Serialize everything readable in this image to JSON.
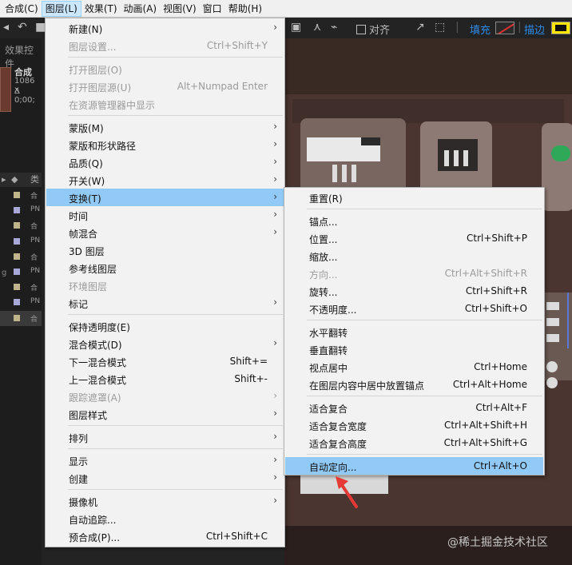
{
  "menubar": {
    "items": [
      {
        "label": "合成(C)",
        "active": false
      },
      {
        "label": "图层(L)",
        "active": true
      },
      {
        "label": "效果(T)",
        "active": false
      },
      {
        "label": "动画(A)",
        "active": false
      },
      {
        "label": "视图(V)",
        "active": false
      },
      {
        "label": "窗口",
        "active": false
      },
      {
        "label": "帮助(H)",
        "active": false
      }
    ]
  },
  "toolbar": {
    "align_label": "对齐",
    "fill_label": "填充",
    "stroke_label": "描边",
    "stroke_color": "#ffe600",
    "fill_none_color": "#dd3333"
  },
  "left_panel": {
    "header": "效果控件",
    "comp_name": "合成",
    "comp_size": "1086 x",
    "comp_duration": "Δ 0;00;",
    "list_header": "类",
    "rows": [
      {
        "text": "合",
        "swatch": "#bfb48a"
      },
      {
        "text": "PN",
        "swatch": "#a8a8d8"
      },
      {
        "text": "合",
        "swatch": "#bfb48a"
      },
      {
        "text": "PN",
        "swatch": "#a8a8d8"
      },
      {
        "text": "合",
        "swatch": "#bfb48a"
      },
      {
        "text": "PN",
        "swatch": "#a8a8d8"
      },
      {
        "text": "合",
        "swatch": "#bfb48a"
      },
      {
        "text": "PN",
        "swatch": "#a8a8d8"
      },
      {
        "text": "合",
        "swatch": "#bfb48a"
      }
    ],
    "side_letter": "g"
  },
  "layer_menu": {
    "items": [
      {
        "type": "item",
        "label": "新建(N)",
        "shortcut": "",
        "submenu": true,
        "disabled": false
      },
      {
        "type": "item",
        "label": "图层设置...",
        "shortcut": "Ctrl+Shift+Y",
        "submenu": false,
        "disabled": true
      },
      {
        "type": "sep"
      },
      {
        "type": "item",
        "label": "打开图层(O)",
        "shortcut": "",
        "submenu": false,
        "disabled": true
      },
      {
        "type": "item",
        "label": "打开图层源(U)",
        "shortcut": "Alt+Numpad Enter",
        "submenu": false,
        "disabled": true
      },
      {
        "type": "item",
        "label": "在资源管理器中显示",
        "shortcut": "",
        "submenu": false,
        "disabled": true
      },
      {
        "type": "sep"
      },
      {
        "type": "item",
        "label": "蒙版(M)",
        "shortcut": "",
        "submenu": true,
        "disabled": false
      },
      {
        "type": "item",
        "label": "蒙版和形状路径",
        "shortcut": "",
        "submenu": true,
        "disabled": false
      },
      {
        "type": "item",
        "label": "品质(Q)",
        "shortcut": "",
        "submenu": true,
        "disabled": false
      },
      {
        "type": "item",
        "label": "开关(W)",
        "shortcut": "",
        "submenu": true,
        "disabled": false
      },
      {
        "type": "item",
        "label": "变换(T)",
        "shortcut": "",
        "submenu": true,
        "disabled": false,
        "highlight": true
      },
      {
        "type": "item",
        "label": "时间",
        "shortcut": "",
        "submenu": true,
        "disabled": false
      },
      {
        "type": "item",
        "label": "帧混合",
        "shortcut": "",
        "submenu": true,
        "disabled": false
      },
      {
        "type": "item",
        "label": "3D 图层",
        "shortcut": "",
        "submenu": false,
        "disabled": false
      },
      {
        "type": "item",
        "label": "参考线图层",
        "shortcut": "",
        "submenu": false,
        "disabled": false
      },
      {
        "type": "item",
        "label": "环境图层",
        "shortcut": "",
        "submenu": false,
        "disabled": true
      },
      {
        "type": "item",
        "label": "标记",
        "shortcut": "",
        "submenu": true,
        "disabled": false
      },
      {
        "type": "sep"
      },
      {
        "type": "item",
        "label": "保持透明度(E)",
        "shortcut": "",
        "submenu": false,
        "disabled": false
      },
      {
        "type": "item",
        "label": "混合模式(D)",
        "shortcut": "",
        "submenu": true,
        "disabled": false
      },
      {
        "type": "item",
        "label": "下一混合模式",
        "shortcut": "Shift+=",
        "submenu": false,
        "disabled": false
      },
      {
        "type": "item",
        "label": "上一混合模式",
        "shortcut": "Shift+-",
        "submenu": false,
        "disabled": false
      },
      {
        "type": "item",
        "label": "跟踪遮罩(A)",
        "shortcut": "",
        "submenu": true,
        "disabled": true
      },
      {
        "type": "item",
        "label": "图层样式",
        "shortcut": "",
        "submenu": true,
        "disabled": false
      },
      {
        "type": "sep"
      },
      {
        "type": "item",
        "label": "排列",
        "shortcut": "",
        "submenu": true,
        "disabled": false
      },
      {
        "type": "sep"
      },
      {
        "type": "item",
        "label": "显示",
        "shortcut": "",
        "submenu": true,
        "disabled": false
      },
      {
        "type": "item",
        "label": "创建",
        "shortcut": "",
        "submenu": true,
        "disabled": false
      },
      {
        "type": "sep"
      },
      {
        "type": "item",
        "label": "摄像机",
        "shortcut": "",
        "submenu": true,
        "disabled": false
      },
      {
        "type": "item",
        "label": "自动追踪...",
        "shortcut": "",
        "submenu": false,
        "disabled": false
      },
      {
        "type": "item",
        "label": "预合成(P)...",
        "shortcut": "Ctrl+Shift+C",
        "submenu": false,
        "disabled": false
      }
    ]
  },
  "transform_menu": {
    "items": [
      {
        "type": "item",
        "label": "重置(R)",
        "shortcut": "",
        "disabled": false
      },
      {
        "type": "sep"
      },
      {
        "type": "item",
        "label": "锚点...",
        "shortcut": "",
        "disabled": false
      },
      {
        "type": "item",
        "label": "位置...",
        "shortcut": "Ctrl+Shift+P",
        "disabled": false
      },
      {
        "type": "item",
        "label": "缩放...",
        "shortcut": "",
        "disabled": false
      },
      {
        "type": "item",
        "label": "方向...",
        "shortcut": "Ctrl+Alt+Shift+R",
        "disabled": true
      },
      {
        "type": "item",
        "label": "旋转...",
        "shortcut": "Ctrl+Shift+R",
        "disabled": false
      },
      {
        "type": "item",
        "label": "不透明度...",
        "shortcut": "Ctrl+Shift+O",
        "disabled": false
      },
      {
        "type": "sep"
      },
      {
        "type": "item",
        "label": "水平翻转",
        "shortcut": "",
        "disabled": false
      },
      {
        "type": "item",
        "label": "垂直翻转",
        "shortcut": "",
        "disabled": false
      },
      {
        "type": "item",
        "label": "视点居中",
        "shortcut": "Ctrl+Home",
        "disabled": false
      },
      {
        "type": "item",
        "label": "在图层内容中居中放置锚点",
        "shortcut": "Ctrl+Alt+Home",
        "disabled": false
      },
      {
        "type": "sep"
      },
      {
        "type": "item",
        "label": "适合复合",
        "shortcut": "Ctrl+Alt+F",
        "disabled": false
      },
      {
        "type": "item",
        "label": "适合复合宽度",
        "shortcut": "Ctrl+Alt+Shift+H",
        "disabled": false
      },
      {
        "type": "item",
        "label": "适合复合高度",
        "shortcut": "Ctrl+Alt+Shift+G",
        "disabled": false
      },
      {
        "type": "sep"
      },
      {
        "type": "item",
        "label": "自动定向...",
        "shortcut": "Ctrl+Alt+O",
        "disabled": false,
        "highlight": true
      }
    ]
  },
  "annotation_color": "#e53935",
  "watermark": "@稀土掘金技术社区"
}
